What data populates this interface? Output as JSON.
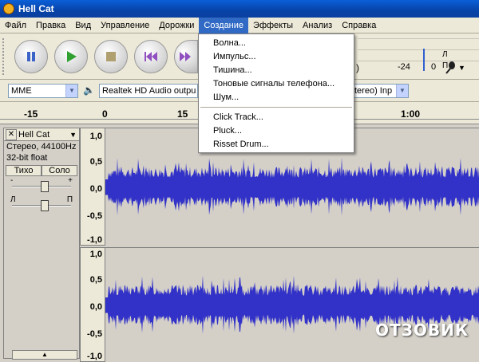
{
  "window": {
    "title": "Hell Cat"
  },
  "menu_bar": [
    "Файл",
    "Правка",
    "Вид",
    "Управление",
    "Дорожки",
    "Создание",
    "Эффекты",
    "Анализ",
    "Справка"
  ],
  "active_menu": "Создание",
  "create_menu": {
    "group1": [
      "Волна...",
      "Импульс...",
      "Тишина...",
      "Тоновые сигналы телефона...",
      "Шум..."
    ],
    "group2": [
      "Click Track...",
      "Pluck...",
      "Risset Drum..."
    ]
  },
  "transport": {
    "pause_icon": "pause-icon",
    "play_icon": "play-icon",
    "stop_icon": "stop-icon",
    "skip_start_icon": "skip-start-icon",
    "skip_end_icon": "skip-end-icon"
  },
  "meter": {
    "label_left": "Л",
    "label_right": "П",
    "db_scale": [
      "-24",
      "0"
    ]
  },
  "device_toolbar": {
    "host": "MME",
    "output": "Realtek HD Audio outpu",
    "input": "tereo) Inp"
  },
  "timeline": {
    "ticks": [
      "-15",
      "0",
      "15",
      "1:00"
    ]
  },
  "track": {
    "name": "Hell Cat",
    "info_line1": "Стерео, 44100Hz",
    "info_line2": "32-bit float",
    "mute": "Тихо",
    "solo": "Соло",
    "gain_minus": "-",
    "gain_plus": "+",
    "pan_left": "Л",
    "pan_right": "П"
  },
  "vscale": [
    "1,0",
    "0,5",
    "0,0",
    "-0,5",
    "-1,0"
  ],
  "waveform_color": "#3232c8",
  "watermark": "ОТЗОВИК"
}
